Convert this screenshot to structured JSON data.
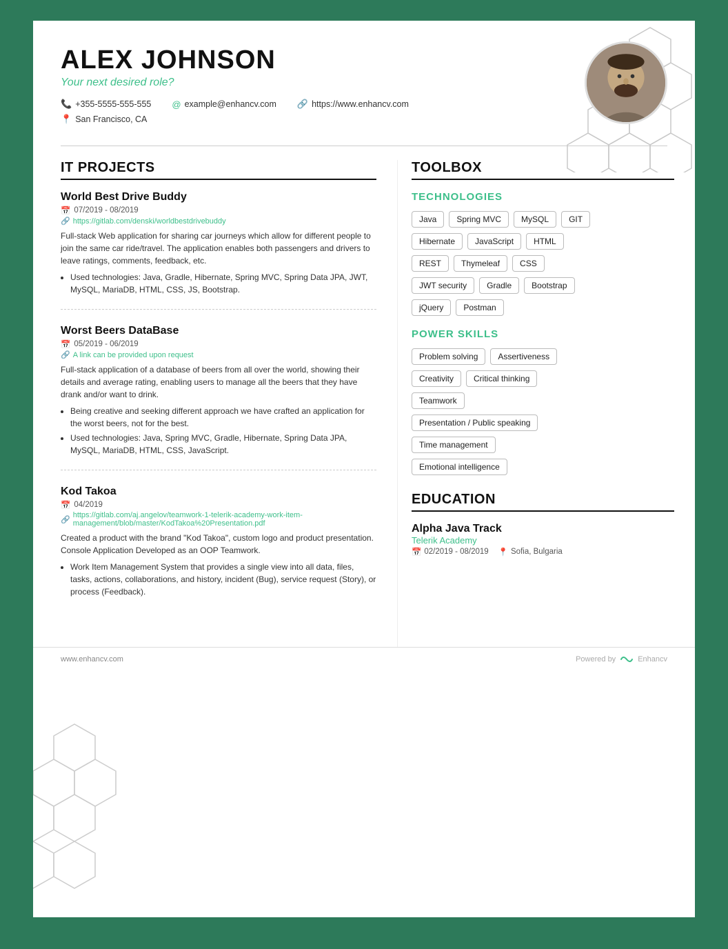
{
  "header": {
    "name": "ALEX JOHNSON",
    "subtitle": "Your next desired role?",
    "phone": "+355-5555-555-555",
    "website": "https://www.enhancv.com",
    "email": "example@enhancv.com",
    "location": "San Francisco, CA"
  },
  "left": {
    "section_title": "IT PROJECTS",
    "projects": [
      {
        "title": "World Best Drive Buddy",
        "date": "07/2019 - 08/2019",
        "link": "https://gitlab.com/denski/worldbestdrivebuddy",
        "description": "Full-stack Web application for sharing car journeys which allow for different people to join the same car ride/travel. The application enables both passengers and drivers to leave ratings, comments, feedback, etc.",
        "bullets": [
          "Used technologies: Java, Gradle, Hibernate, Spring MVC, Spring Data JPA, JWT, MySQL, MariaDB, HTML, CSS, JS, Bootstrap."
        ]
      },
      {
        "title": "Worst Beers DataBase",
        "date": "05/2019 - 06/2019",
        "link": "A link can be provided upon request",
        "description": "Full-stack application of a database of beers from all over the world, showing their details and average rating, enabling users to manage all the beers that they have drank and/or want to drink.",
        "bullets": [
          "Being creative and seeking different approach we have crafted an application for the worst beers, not for the best.",
          "Used technologies: Java, Spring MVC, Gradle, Hibernate, Spring Data JPA, MySQL, MariaDB, HTML, CSS, JavaScript."
        ]
      },
      {
        "title": "Kod Takoa",
        "date": "04/2019",
        "link": "https://gitlab.com/aj.angelov/teamwork-1-telerik-academy-work-item-management/blob/master/KodTakoa%20Presentation.pdf",
        "description": "Created a product with the brand \"Kod Takoa\", custom logo and product presentation. Console Application Developed as an OOP Teamwork.",
        "bullets": [
          "Work Item Management System that provides a single view into all data, files, tasks, actions, collaborations, and history, incident (Bug), service request (Story), or process (Feedback)."
        ]
      }
    ]
  },
  "right": {
    "toolbox_title": "TOOLBOX",
    "technologies_title": "TECHNOLOGIES",
    "technologies": [
      "Java",
      "Spring MVC",
      "MySQL",
      "GIT",
      "Hibernate",
      "JavaScript",
      "HTML",
      "REST",
      "Thymeleaf",
      "CSS",
      "JWT security",
      "Gradle",
      "Bootstrap",
      "jQuery",
      "Postman"
    ],
    "power_skills_title": "POWER SKILLS",
    "power_skills": [
      "Problem solving",
      "Assertiveness",
      "Creativity",
      "Critical thinking",
      "Teamwork",
      "Presentation / Public speaking",
      "Time management",
      "Emotional intelligence"
    ],
    "education_title": "EDUCATION",
    "education": [
      {
        "degree": "Alpha Java Track",
        "school": "Telerik Academy",
        "date": "02/2019 - 08/2019",
        "location": "Sofia, Bulgaria"
      }
    ]
  },
  "footer": {
    "website": "www.enhancv.com",
    "powered_by": "Powered by",
    "brand": "Enhancv"
  }
}
